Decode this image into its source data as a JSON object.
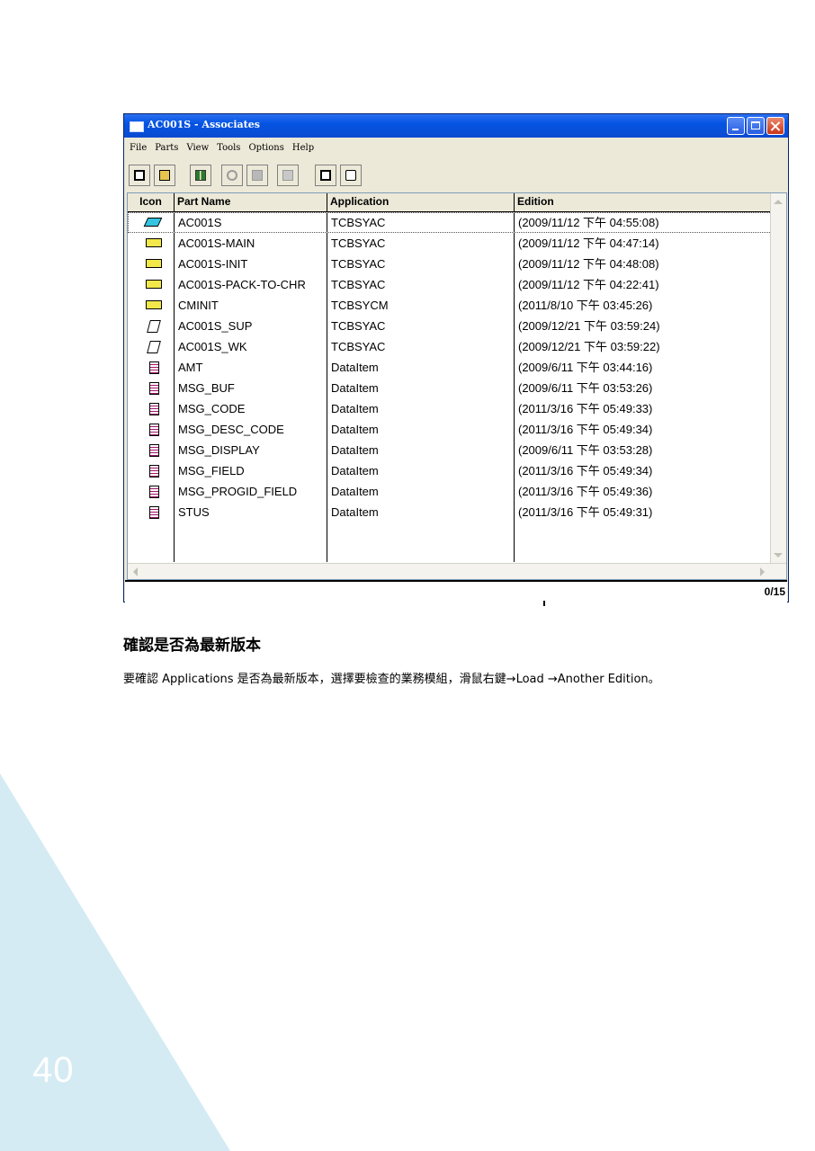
{
  "window": {
    "title": "AC001S - Associates",
    "menu": [
      "File",
      "Parts",
      "View",
      "Tools",
      "Options",
      "Help"
    ],
    "toolbar_icons": [
      "edit-icon",
      "open-folder-icon",
      "load-icon",
      "refresh-icon",
      "check-icon",
      "paste-icon",
      "save-icon",
      "find-icon"
    ],
    "columns": [
      "Icon",
      "Part Name",
      "Application",
      "Edition"
    ],
    "rows": [
      {
        "icon": "parallelogram",
        "name": "AC001S",
        "app": "TCBSYAC",
        "edition": "(2009/11/12 下午 04:55:08)"
      },
      {
        "icon": "rect",
        "name": "AC001S-MAIN",
        "app": "TCBSYAC",
        "edition": "(2009/11/12 下午 04:47:14)"
      },
      {
        "icon": "rect",
        "name": "AC001S-INIT",
        "app": "TCBSYAC",
        "edition": "(2009/11/12 下午 04:48:08)"
      },
      {
        "icon": "rect",
        "name": "AC001S-PACK-TO-CHR",
        "app": "TCBSYAC",
        "edition": "(2009/11/12 下午 04:22:41)"
      },
      {
        "icon": "rect",
        "name": "CMINIT",
        "app": "TCBSYCM",
        "edition": "(2011/8/10 下午 03:45:26)"
      },
      {
        "icon": "note",
        "name": "AC001S_SUP",
        "app": "TCBSYAC",
        "edition": "(2009/12/21 下午 03:59:24)"
      },
      {
        "icon": "note",
        "name": "AC001S_WK",
        "app": "TCBSYAC",
        "edition": "(2009/12/21 下午 03:59:22)"
      },
      {
        "icon": "doc",
        "name": "AMT",
        "app": "DataItem",
        "edition": "(2009/6/11 下午 03:44:16)"
      },
      {
        "icon": "doc",
        "name": "MSG_BUF",
        "app": "DataItem",
        "edition": "(2009/6/11 下午 03:53:26)"
      },
      {
        "icon": "doc",
        "name": "MSG_CODE",
        "app": "DataItem",
        "edition": "(2011/3/16 下午 05:49:33)"
      },
      {
        "icon": "doc",
        "name": "MSG_DESC_CODE",
        "app": "DataItem",
        "edition": "(2011/3/16 下午 05:49:34)"
      },
      {
        "icon": "doc",
        "name": "MSG_DISPLAY",
        "app": "DataItem",
        "edition": "(2009/6/11 下午 03:53:28)"
      },
      {
        "icon": "doc",
        "name": "MSG_FIELD",
        "app": "DataItem",
        "edition": "(2011/3/16 下午 05:49:34)"
      },
      {
        "icon": "doc",
        "name": "MSG_PROGID_FIELD",
        "app": "DataItem",
        "edition": "(2011/3/16 下午 05:49:36)"
      },
      {
        "icon": "doc",
        "name": "STUS",
        "app": "DataItem",
        "edition": "(2011/3/16 下午 05:49:31)"
      }
    ],
    "status_count": "0/15"
  },
  "section": {
    "title": "確認是否為最新版本",
    "paragraph": "要確認 Applications 是否為最新版本，選擇要檢查的業務模組，滑鼠右鍵→Load →Another Edition。"
  },
  "page_number": "40"
}
